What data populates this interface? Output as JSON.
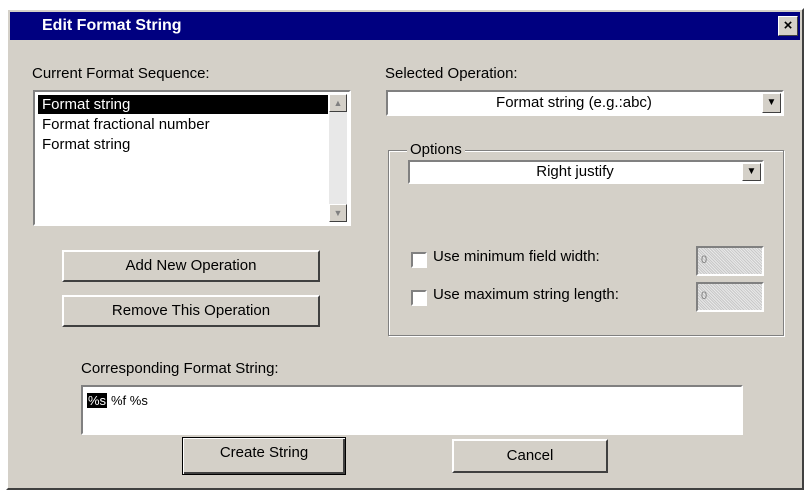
{
  "window": {
    "title": "Edit Format String",
    "close_icon": "×"
  },
  "sequence": {
    "label": "Current Format Sequence:",
    "items": [
      "Format string",
      "Format fractional number",
      "Format string"
    ],
    "selected_index": 0
  },
  "operation": {
    "label": "Selected Operation:",
    "value": "Format string   (e.g.:abc)"
  },
  "options": {
    "label": "Options",
    "justify_value": "Right justify",
    "min_width_label": "Use minimum field width:",
    "min_width_value": "0",
    "max_length_label": "Use maximum string length:",
    "max_length_value": "0"
  },
  "buttons": {
    "add": "Add New Operation",
    "remove": "Remove This Operation",
    "create": "Create String",
    "cancel": "Cancel"
  },
  "format": {
    "label": "Corresponding Format String:",
    "selected": "%s",
    "rest": " %f %s"
  },
  "icons": {
    "scroll_up": "▲",
    "scroll_down": "▼",
    "dropdown": "▼"
  }
}
